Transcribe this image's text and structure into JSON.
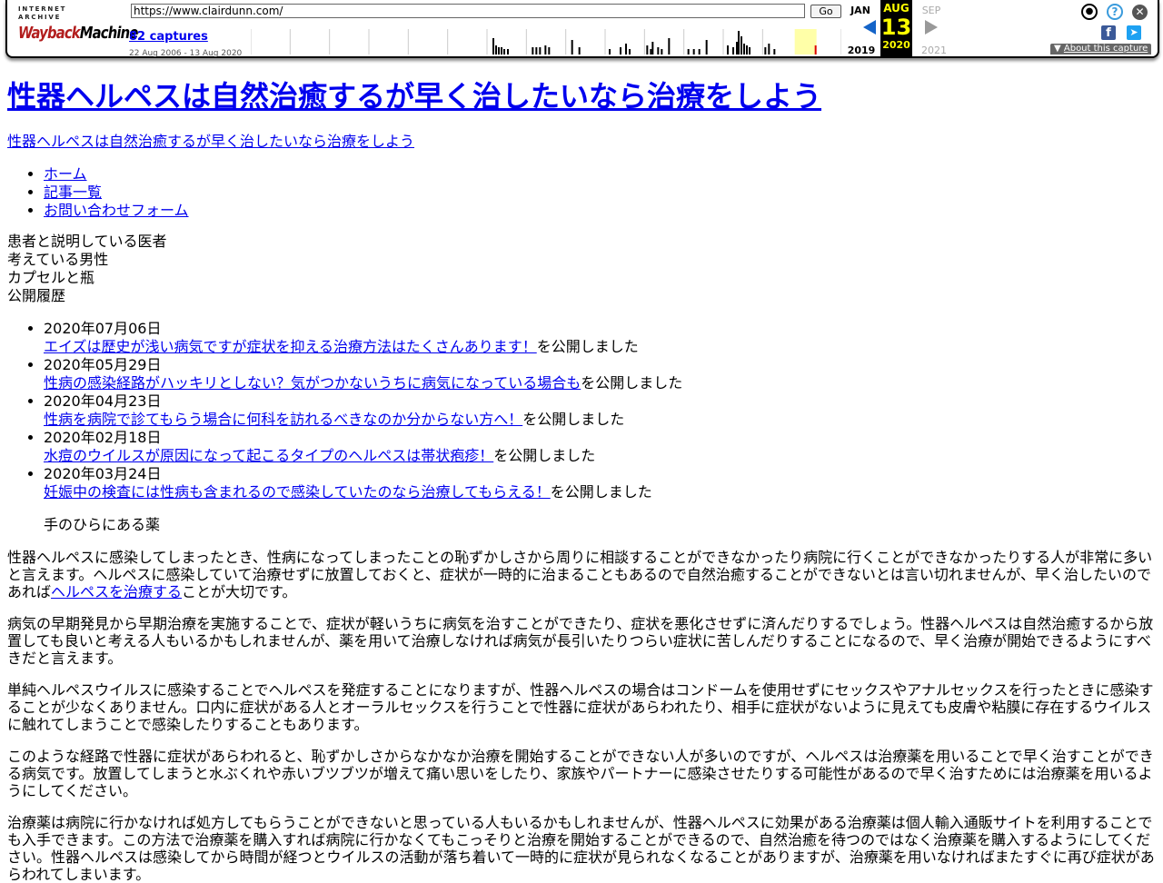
{
  "wayback": {
    "logo_top": "INTERNET ARCHIVE",
    "logo_main_a": "Wayback",
    "logo_main_b": "Machine",
    "url": "https://www.clairdunn.com/",
    "go_label": "Go",
    "captures": "82 captures",
    "range": "22 Aug 2006 - 13 Aug 2020",
    "prev_month": "JAN",
    "cur_month": "AUG",
    "cur_day": "13",
    "next_month": "SEP",
    "prev_year": "2019",
    "cur_year": "2020",
    "next_year": "2021",
    "about": "About this capture",
    "sparkline": [
      0,
      0,
      0,
      0,
      0,
      0,
      0,
      0,
      0,
      0,
      0,
      0,
      0,
      0,
      0,
      0,
      0,
      0,
      0,
      0,
      0,
      0,
      0,
      0,
      0,
      0,
      0,
      0,
      0,
      0,
      0,
      0,
      0,
      0,
      0,
      0,
      0,
      0,
      0,
      0,
      0,
      0,
      0,
      0,
      0,
      0,
      0,
      0,
      0,
      0,
      0,
      0,
      0,
      0,
      0,
      0,
      0,
      0,
      0,
      0,
      0,
      0,
      0,
      0,
      0,
      0,
      0,
      0,
      0,
      0,
      0,
      0,
      0,
      0,
      0,
      0,
      0,
      0,
      0,
      0,
      0,
      0,
      0,
      0,
      0,
      0,
      0,
      0,
      0,
      0,
      0,
      0,
      0,
      0,
      0,
      0,
      0,
      0,
      0,
      0,
      0,
      0,
      0,
      0,
      0,
      0,
      0,
      0,
      0,
      0,
      0,
      0,
      0,
      0,
      0,
      0,
      0,
      0,
      0,
      0,
      0,
      0,
      0,
      0,
      0,
      0,
      0,
      0,
      0,
      0,
      0,
      0,
      0,
      0,
      0,
      0,
      0,
      0,
      0,
      0,
      0,
      0,
      0,
      0,
      0,
      0,
      0,
      0,
      0,
      0,
      0,
      0,
      0,
      0,
      0,
      0,
      0,
      0,
      0,
      0,
      0,
      0,
      0,
      0,
      0,
      0,
      0,
      0,
      0,
      0,
      0,
      0,
      0,
      0,
      0,
      0,
      0,
      0,
      0,
      0,
      0,
      0,
      0,
      0,
      0,
      0,
      0,
      0,
      0,
      0,
      0,
      0,
      0,
      0,
      0,
      0,
      0,
      0,
      0,
      0,
      0,
      0,
      0,
      0,
      0,
      0,
      0,
      0,
      0,
      0,
      0,
      0,
      0,
      0,
      0,
      0,
      0,
      0,
      0,
      0,
      0,
      0,
      0,
      0,
      0,
      0,
      0,
      0,
      0,
      0,
      0,
      0,
      0,
      0,
      0,
      0,
      0,
      0,
      0,
      0,
      0,
      0,
      0,
      0,
      0,
      0,
      0,
      0,
      0,
      0,
      0,
      0,
      0,
      0,
      0,
      0,
      0,
      0,
      0,
      0,
      0,
      0,
      0,
      0,
      0,
      0,
      0,
      0,
      0,
      0,
      0,
      0,
      0,
      0,
      0,
      0,
      0,
      0,
      0,
      0,
      0,
      0,
      0,
      0,
      0,
      0,
      0,
      0,
      0,
      0,
      0,
      0,
      0,
      0,
      0,
      0,
      0,
      0,
      0,
      0,
      0,
      0,
      0,
      0,
      0,
      0,
      0,
      0,
      0,
      0,
      0,
      0,
      0,
      0,
      0,
      0,
      0,
      0,
      0,
      0,
      0,
      0,
      0,
      0,
      0,
      0,
      0,
      0,
      0,
      0,
      0,
      0,
      0,
      0,
      0,
      0,
      0,
      0,
      0,
      0,
      0,
      0,
      0,
      0,
      0,
      0,
      0,
      0,
      0,
      0,
      0,
      0,
      0,
      0,
      0,
      0,
      0,
      0,
      0,
      0,
      0,
      0,
      0,
      0,
      0,
      0,
      0,
      0,
      0,
      0,
      0,
      0,
      0,
      0,
      0,
      0,
      0,
      0,
      0,
      0,
      0,
      0,
      0,
      0,
      0,
      0,
      0,
      0,
      0,
      0,
      0,
      0,
      0,
      0,
      0,
      0,
      0,
      0,
      0,
      0,
      0,
      0,
      0,
      0,
      0,
      0,
      0,
      0,
      0,
      0,
      0,
      0,
      0,
      0,
      0,
      0,
      0,
      0,
      0,
      0,
      0,
      0,
      0,
      0,
      0,
      0,
      0,
      0,
      0,
      0,
      0,
      0,
      0,
      0,
      0,
      0,
      0,
      0,
      0,
      0,
      0,
      0,
      0,
      0,
      0,
      0,
      0,
      0,
      0,
      0,
      0,
      0,
      0,
      0,
      0,
      0,
      0,
      0,
      0,
      0,
      0,
      0,
      0,
      0,
      0,
      0,
      0,
      0,
      0,
      0,
      0,
      0,
      0,
      0,
      0,
      0,
      0,
      0,
      0,
      0,
      0,
      0,
      0,
      0,
      0,
      0,
      0,
      0,
      0,
      0,
      0,
      0,
      0,
      0,
      0,
      0,
      0,
      0,
      0,
      0,
      0,
      0,
      0,
      0,
      0,
      0,
      0,
      0,
      0,
      0,
      0,
      0,
      0,
      0,
      0,
      0,
      0,
      0,
      0,
      0,
      0,
      0,
      0,
      0,
      0,
      0,
      0,
      0,
      0,
      0,
      0,
      0,
      0,
      0,
      0,
      0,
      0,
      0,
      0,
      0,
      0,
      0,
      0,
      0,
      0,
      0,
      0,
      0,
      0,
      0,
      0,
      0,
      0,
      0,
      0,
      0,
      0,
      0,
      0,
      0,
      0,
      0,
      0,
      0,
      0,
      0,
      0,
      0,
      0,
      0,
      0,
      0,
      0,
      0,
      0,
      0,
      0,
      0,
      0,
      0,
      0,
      0,
      0,
      0,
      0,
      0,
      0,
      0,
      0,
      0,
      0,
      0,
      0,
      0,
      0,
      0,
      0,
      0,
      0,
      0,
      0,
      0,
      0,
      0,
      0,
      0,
      0,
      0,
      0,
      0,
      0,
      0,
      0,
      0,
      0,
      0,
      0,
      0,
      0,
      0,
      0,
      0,
      0,
      0,
      0,
      0,
      0,
      0,
      0,
      0,
      0,
      0,
      0,
      0,
      0,
      0,
      0,
      0,
      0,
      0,
      0,
      0,
      0,
      0,
      0,
      0,
      0,
      0,
      0,
      0,
      0,
      0,
      0,
      0,
      0,
      0,
      0,
      0,
      0,
      0,
      0,
      0,
      0,
      0,
      0,
      0,
      0,
      0,
      0,
      0,
      0,
      0,
      0,
      0,
      0,
      0,
      0,
      0,
      0,
      0,
      0,
      0,
      0,
      0,
      0,
      0,
      0,
      0,
      0,
      0,
      0,
      0,
      0,
      0,
      0,
      0,
      0,
      0,
      0,
      0,
      0,
      0,
      0,
      0,
      0,
      0,
      0,
      0,
      0,
      0,
      0,
      0,
      0
    ]
  },
  "site": {
    "title": "性器ヘルペスは自然治癒するが早く治したいなら治療をしよう",
    "description": "性器ヘルペスは自然治癒するが早く治したいなら治療をしよう",
    "nav": [
      "ホーム",
      "記事一覧",
      "お問い合わせフォーム"
    ],
    "images": [
      "患者と説明している医者",
      "考えている男性",
      "カプセルと瓶"
    ],
    "history_label": "公開履歴",
    "posts": [
      {
        "date": "2020年07月06日",
        "title": "エイズは歴史が浅い病気ですが症状を抑える治療方法はたくさんあります！",
        "suffix": "を公開しました"
      },
      {
        "date": "2020年05月29日",
        "title": "性病の感染経路がハッキリとしない？気がつかないうちに病気になっている場合も",
        "suffix": "を公開しました"
      },
      {
        "date": "2020年04月23日",
        "title": "性病を病院で診てもらう場合に何科を訪れるべきなのか分からない方へ！",
        "suffix": "を公開しました"
      },
      {
        "date": "2020年02月18日",
        "title": "水痘のウイルスが原因になって起こるタイプのヘルペスは帯状疱疹！",
        "suffix": "を公開しました"
      },
      {
        "date": "2020年03月24日",
        "title": "妊娠中の検査には性病も含まれるので感染していたのなら治療してもらえる！",
        "suffix": "を公開しました"
      }
    ],
    "figure_alt": "手のひらにある薬",
    "p1_before": "性器ヘルペスに感染してしまったとき、性病になってしまったことの恥ずかしさから周りに相談することができなかったり病院に行くことができなかったりする人が非常に多いと言えます。ヘルペスに感染していて治療せずに放置しておくと、症状が一時的に治まることもあるので自然治癒することができないとは言い切れませんが、早く治したいのであれば",
    "p1_link": "ヘルペスを治療する",
    "p1_after": "ことが大切です。",
    "p2": "病気の早期発見から早期治療を実施することで、症状が軽いうちに病気を治すことができたり、症状を悪化させずに済んだりするでしょう。性器ヘルペスは自然治癒するから放置しても良いと考える人もいるかもしれませんが、薬を用いて治療しなければ病気が長引いたりつらい症状に苦しんだりすることになるので、早く治療が開始できるようにすべきだと言えます。",
    "p3": "単純ヘルペスウイルスに感染することでヘルペスを発症することになりますが、性器ヘルペスの場合はコンドームを使用せずにセックスやアナルセックスを行ったときに感染することが少なくありません。口内に症状がある人とオーラルセックスを行うことで性器に症状があらわれたり、相手に症状がないように見えても皮膚や粘膜に存在するウイルスに触れてしまうことで感染したりすることもあります。",
    "p4": "このような経路で性器に症状があらわれると、恥ずかしさからなかなか治療を開始することができない人が多いのですが、ヘルペスは治療薬を用いることで早く治すことができる病気です。放置してしまうと水ぶくれや赤いブツブツが増えて痛い思いをしたり、家族やパートナーに感染させたりする可能性があるので早く治すためには治療薬を用いるようにしてください。",
    "p5": "治療薬は病院に行かなければ処方してもらうことができないと思っている人もいるかもしれませんが、性器ヘルペスに効果がある治療薬は個人輸入通販サイトを利用することでも入手できます。この方法で治療薬を購入すれば病院に行かなくてもこっそりと治療を開始することができるので、自然治癒を待つのではなく治療薬を購入するようにしてください。性器ヘルペスは感染してから時間が経つとウイルスの活動が落ち着いて一時的に症状が見られなくなることがありますが、治療薬を用いなければまたすぐに再び症状があらわれてしまいます。"
  }
}
